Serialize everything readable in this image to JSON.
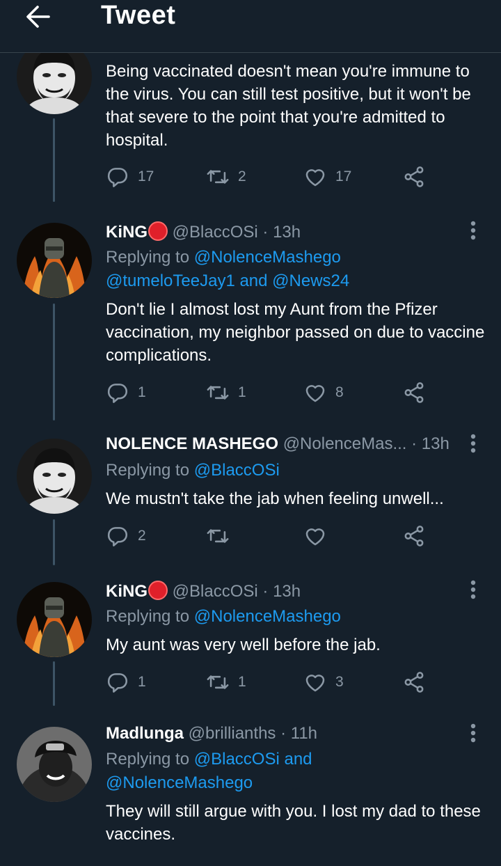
{
  "header": {
    "title": "Tweet"
  },
  "tweets": [
    {
      "body": "Being vaccinated doesn't mean you're immune to the virus. You can still test positive, but it won't be that severe to the point that you're admitted to hospital.",
      "stats": {
        "replies": "17",
        "retweets": "2",
        "likes": "17"
      }
    },
    {
      "name": "KiNG",
      "handle": "@BlaccOSi",
      "time": "· 13h",
      "reply_label": "Replying to",
      "reply_to_1": "@NolenceMashego",
      "reply_to_2": "@tumeloTeeJay1 and @News24",
      "body": "Don't lie I almost lost my Aunt from the Pfizer vaccination, my neighbor passed on due to vaccine complications.",
      "stats": {
        "replies": "1",
        "retweets": "1",
        "likes": "8"
      }
    },
    {
      "name": "NOLENCE MASHEGO",
      "handle": "@NolenceMas...",
      "time": "· 13h",
      "reply_label": "Replying to",
      "reply_to_1": "@BlaccOSi",
      "body": "We mustn't take the jab when feeling unwell...",
      "stats": {
        "replies": "2",
        "retweets": "",
        "likes": ""
      }
    },
    {
      "name": "KiNG",
      "handle": "@BlaccOSi",
      "time": "· 13h",
      "reply_label": "Replying to",
      "reply_to_1": "@NolenceMashego",
      "body": "My aunt was very well before the jab.",
      "stats": {
        "replies": "1",
        "retweets": "1",
        "likes": "3"
      }
    },
    {
      "name": "Madlunga",
      "handle": "@brillianths",
      "time": "· 11h",
      "reply_label": "Replying to",
      "reply_to_1": "@BlaccOSi and",
      "reply_to_2": "@NolenceMashego",
      "body": "They will still argue with you. I lost my dad to these vaccines."
    }
  ],
  "colors": {
    "background": "#15202b",
    "accent": "#1d9bf0",
    "muted": "#8b98a5",
    "live_dot": "#e0202a"
  }
}
